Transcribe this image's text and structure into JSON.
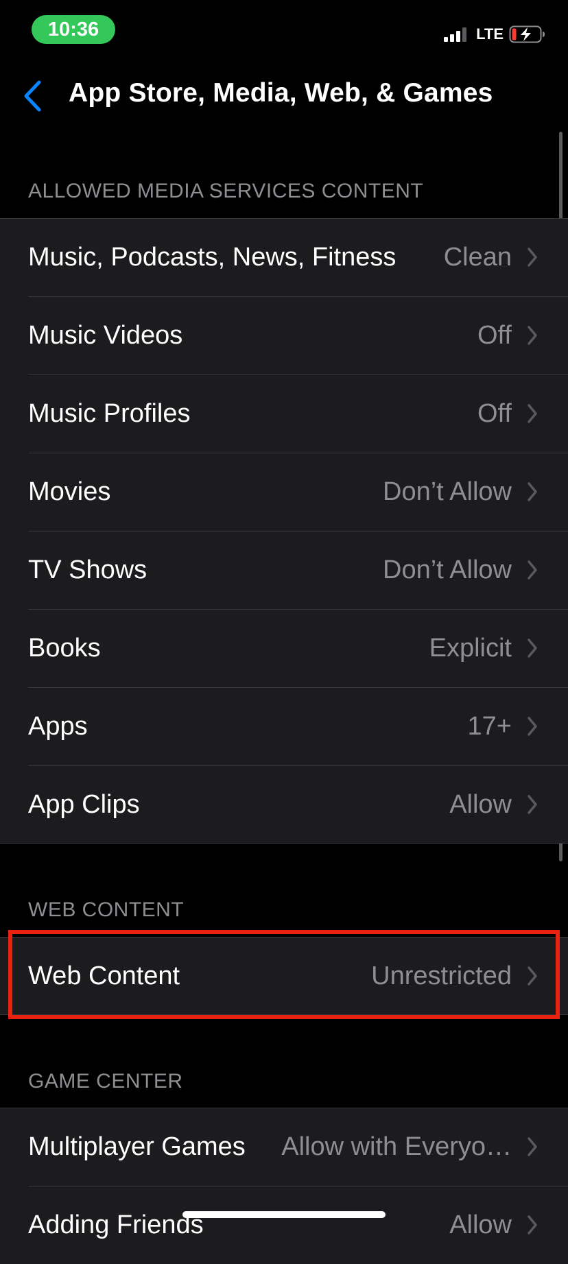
{
  "status_bar": {
    "time": "10:36",
    "network": "LTE",
    "time_pill_color": "#34c759",
    "battery_level": "low",
    "charging": true
  },
  "nav": {
    "back_icon": "chevron-left-icon",
    "title": "App Store, Media, Web, & Games",
    "accent_color": "#0a84ff"
  },
  "sections": {
    "media": {
      "header": "ALLOWED MEDIA SERVICES CONTENT",
      "rows": [
        {
          "label": "Music, Podcasts, News, Fitness",
          "value": "Clean"
        },
        {
          "label": "Music Videos",
          "value": "Off"
        },
        {
          "label": "Music Profiles",
          "value": "Off"
        },
        {
          "label": "Movies",
          "value": "Don’t Allow"
        },
        {
          "label": "TV Shows",
          "value": "Don’t Allow"
        },
        {
          "label": "Books",
          "value": "Explicit"
        },
        {
          "label": "Apps",
          "value": "17+"
        },
        {
          "label": "App Clips",
          "value": "Allow"
        }
      ]
    },
    "web": {
      "header": "WEB CONTENT",
      "rows": [
        {
          "label": "Web Content",
          "value": "Unrestricted"
        }
      ],
      "highlight_color": "#e8220f"
    },
    "game_center": {
      "header": "GAME CENTER",
      "rows": [
        {
          "label": "Multiplayer Games",
          "value": "Allow with Everyo…"
        },
        {
          "label": "Adding Friends",
          "value": "Allow"
        }
      ]
    }
  }
}
